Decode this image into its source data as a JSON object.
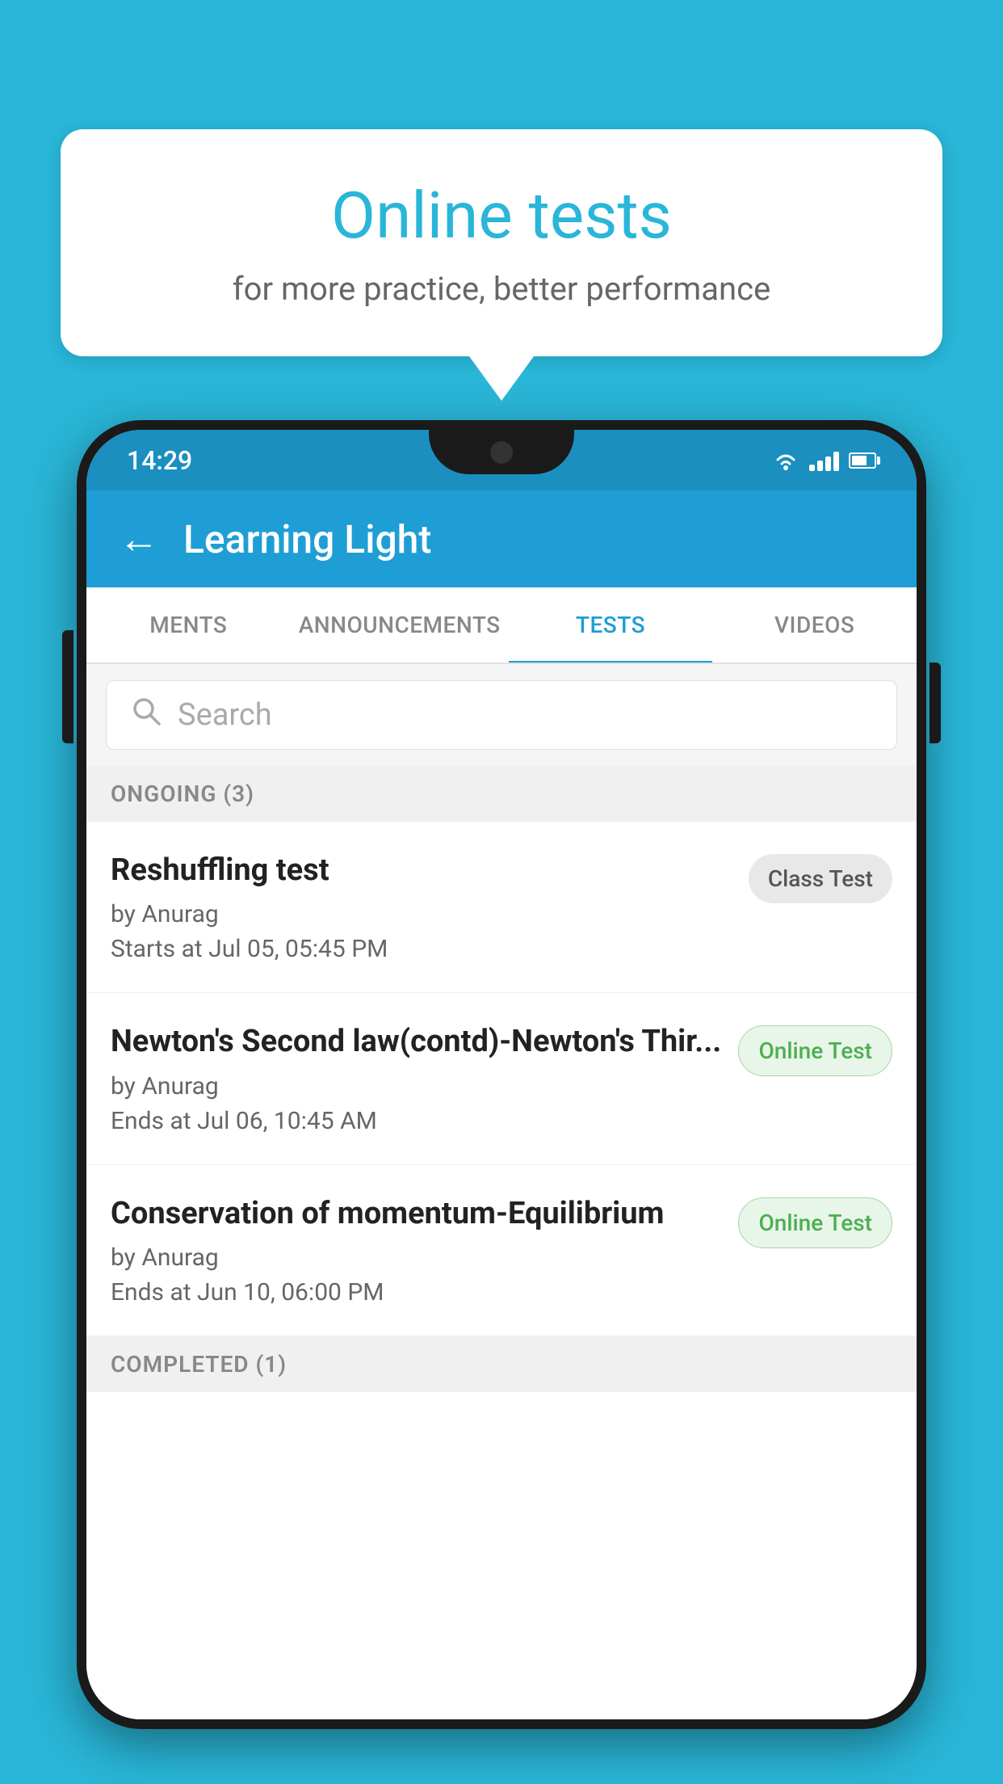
{
  "background_color": "#29b6d8",
  "speech_bubble": {
    "title": "Online tests",
    "subtitle": "for more practice, better performance"
  },
  "phone": {
    "status_bar": {
      "time": "14:29"
    },
    "app_bar": {
      "back_label": "←",
      "title": "Learning Light"
    },
    "tabs": [
      {
        "label": "MENTS",
        "active": false
      },
      {
        "label": "ANNOUNCEMENTS",
        "active": false
      },
      {
        "label": "TESTS",
        "active": true
      },
      {
        "label": "VIDEOS",
        "active": false
      }
    ],
    "search": {
      "placeholder": "Search"
    },
    "ongoing_section": {
      "label": "ONGOING (3)"
    },
    "tests": [
      {
        "title": "Reshuffling test",
        "author": "by Anurag",
        "time": "Starts at  Jul 05, 05:45 PM",
        "badge": "Class Test",
        "badge_type": "class"
      },
      {
        "title": "Newton's Second law(contd)-Newton's Thir...",
        "author": "by Anurag",
        "time": "Ends at  Jul 06, 10:45 AM",
        "badge": "Online Test",
        "badge_type": "online"
      },
      {
        "title": "Conservation of momentum-Equilibrium",
        "author": "by Anurag",
        "time": "Ends at  Jun 10, 06:00 PM",
        "badge": "Online Test",
        "badge_type": "online"
      }
    ],
    "completed_section": {
      "label": "COMPLETED (1)"
    }
  }
}
